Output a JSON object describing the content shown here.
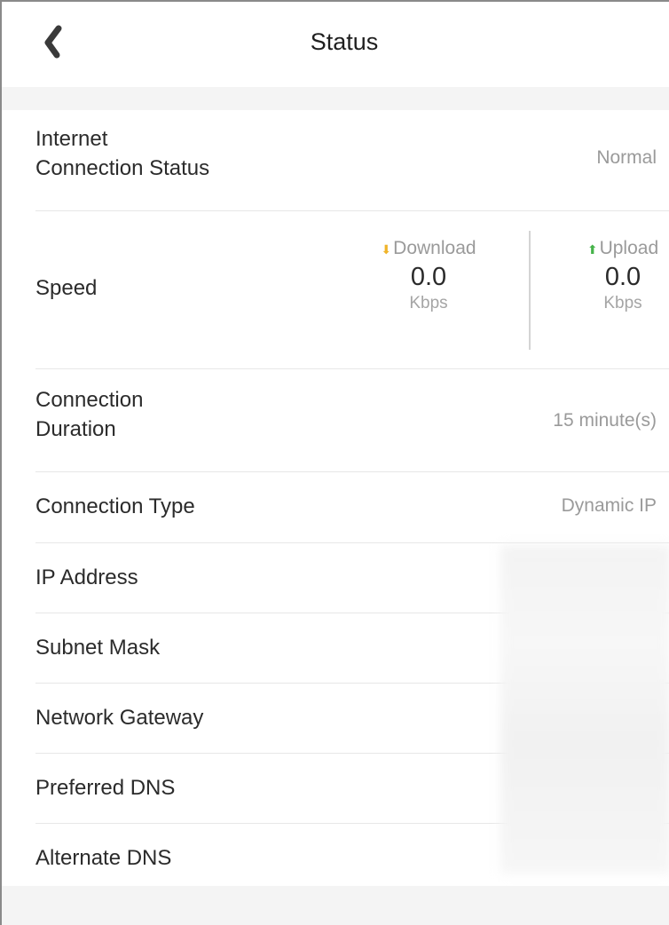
{
  "header": {
    "title": "Status",
    "back_icon": "chevron-left-icon"
  },
  "rows": {
    "internet": {
      "label": "Internet\nConnection Status",
      "value": "Normal"
    },
    "speed": {
      "label": "Speed",
      "download": {
        "label": "Download",
        "value": "0.0",
        "unit": "Kbps",
        "icon": "arrow-down-icon",
        "color": "#f0b429"
      },
      "upload": {
        "label": "Upload",
        "value": "0.0",
        "unit": "Kbps",
        "icon": "arrow-up-icon",
        "color": "#46b34a"
      }
    },
    "duration": {
      "label": "Connection\nDuration",
      "value": "15 minute(s)"
    },
    "type": {
      "label": "Connection Type",
      "value": "Dynamic IP"
    },
    "ip": {
      "label": "IP Address"
    },
    "subnet": {
      "label": "Subnet Mask"
    },
    "gateway": {
      "label": "Network Gateway"
    },
    "dns1": {
      "label": "Preferred DNS"
    },
    "dns2": {
      "label": "Alternate DNS"
    }
  }
}
